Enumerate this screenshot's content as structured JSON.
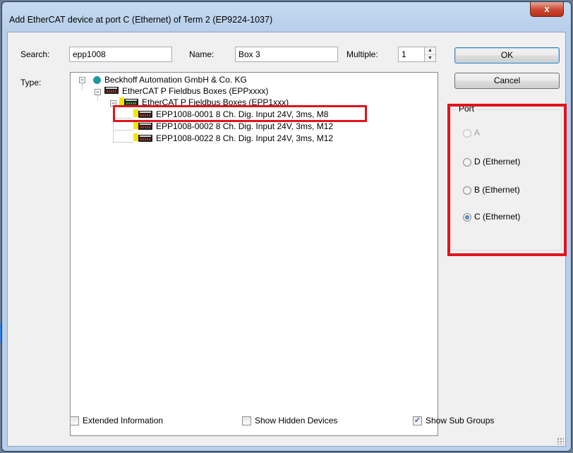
{
  "window": {
    "title": "Add EtherCAT device at port C (Ethernet) of Term 2 (EP9224-1037)",
    "close_label": "x"
  },
  "form": {
    "search_label": "Search:",
    "search_value": "epp1008",
    "name_label": "Name:",
    "name_value": "Box 3",
    "multiple_label": "Multiple:",
    "multiple_value": "1",
    "type_label": "Type:"
  },
  "buttons": {
    "ok": "OK",
    "cancel": "Cancel"
  },
  "tree": {
    "root": "Beckhoff Automation GmbH & Co. KG",
    "group1": "EtherCAT P Fieldbus Boxes (EPPxxxx)",
    "group2": "EtherCAT P Fieldbus Boxes (EPP1xxx)",
    "items": [
      "EPP1008-0001 8 Ch. Dig. Input 24V, 3ms, M8",
      "EPP1008-0002 8 Ch. Dig. Input 24V, 3ms, M12",
      "EPP1008-0022 8 Ch. Dig. Input 24V, 3ms, M12"
    ]
  },
  "port": {
    "title": "Port",
    "options": [
      {
        "label": "A",
        "checked": false,
        "disabled": true
      },
      {
        "label": "D (Ethernet)",
        "checked": false,
        "disabled": false
      },
      {
        "label": "B (Ethernet)",
        "checked": false,
        "disabled": false
      },
      {
        "label": "C (Ethernet)",
        "checked": true,
        "disabled": false
      }
    ]
  },
  "options": {
    "extended_info": {
      "label": "Extended Information",
      "checked": false
    },
    "show_hidden": {
      "label": "Show Hidden Devices",
      "checked": false
    },
    "show_sub": {
      "label": "Show Sub Groups",
      "checked": true
    }
  },
  "colors": {
    "highlight": "#e0141d",
    "title_bg": "#b8cfea"
  }
}
